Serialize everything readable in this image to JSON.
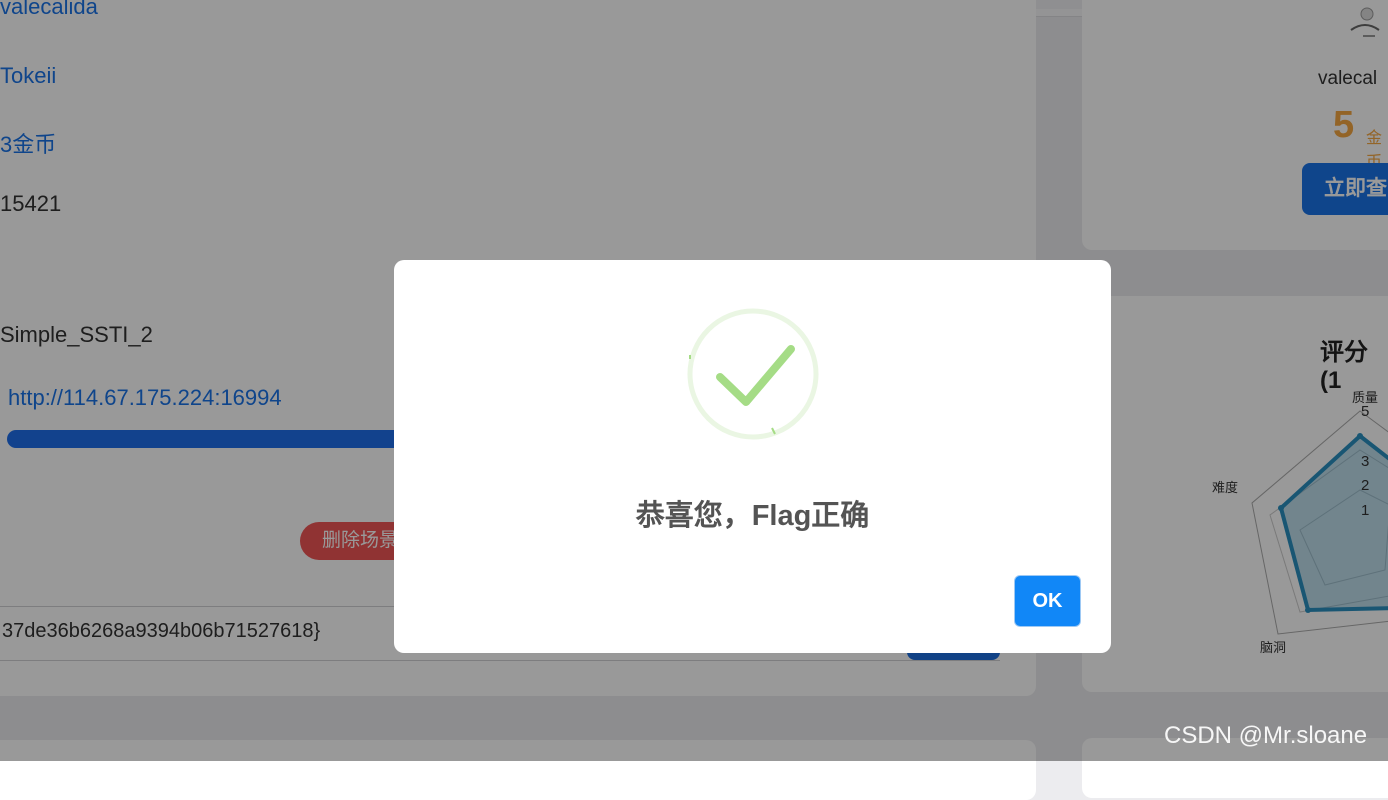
{
  "top_field": "valecalida",
  "challenge": {
    "author": "Tokeii",
    "reward": "3金币",
    "id": "15421",
    "name": "Simple_SSTI_2",
    "url": "http://114.67.175.224:16994",
    "progress_percent": 100,
    "delete_button": "删除场景",
    "flag_value": "37de36b6268a9394b06b71527618}"
  },
  "user_panel": {
    "username": "valecal",
    "coins": "5",
    "coins_unit": "金币",
    "view_button": "立即查"
  },
  "rating": {
    "title": "评分(1",
    "labels": {
      "quality": "质量",
      "difficulty": "难度",
      "brain": "脑洞"
    },
    "ticks": [
      "5",
      "3",
      "2",
      "1"
    ]
  },
  "dialog": {
    "icon": "success-check-icon",
    "title": "恭喜您，Flag正确",
    "ok_label": "OK"
  },
  "watermark": "CSDN @Mr.sloane",
  "colors": {
    "accent": "#1a73e8",
    "ok_button": "#1187f7",
    "danger": "#f05555",
    "coin": "#f5a742",
    "success": "#a5dc86"
  }
}
